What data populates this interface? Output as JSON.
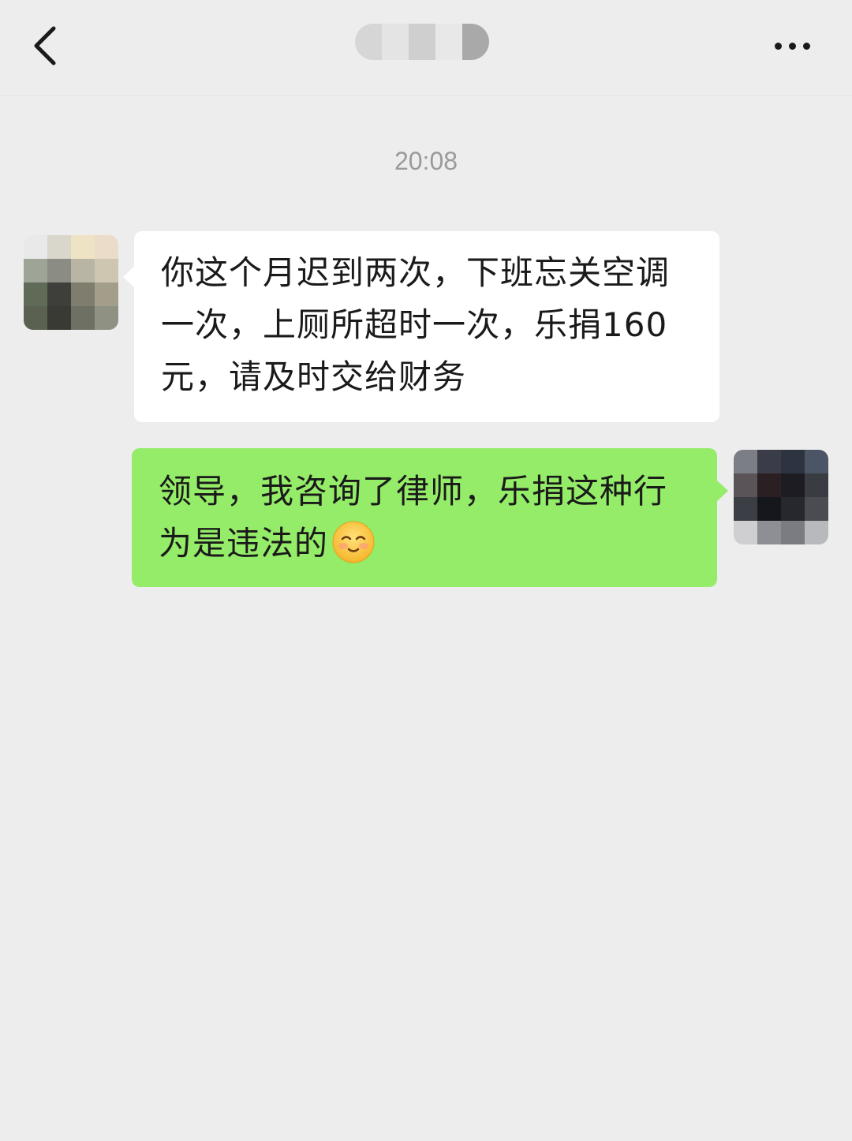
{
  "header": {
    "title_blur_colors": [
      "#d6d6d6",
      "#e4e4e4",
      "#cfcfcf",
      "#e8e8e8",
      "#a9a9a9"
    ]
  },
  "timestamp": "20:08",
  "messages": [
    {
      "direction": "received",
      "text": "你这个月迟到两次，下班忘关空调一次，上厕所超时一次，乐捐160元，请及时交给财务",
      "avatar_colors": [
        "#e9e9e9",
        "#d9d6cc",
        "#efe3c6",
        "#eadcc8",
        "#9ea596",
        "#8b8c84",
        "#b9b5a4",
        "#cfc6b2",
        "#5f6b56",
        "#3e3f3a",
        "#7f7d6d",
        "#a39e8a",
        "#5a6150",
        "#3a3a34",
        "#6e7064",
        "#8f9283"
      ],
      "bubble_color": "#ffffff"
    },
    {
      "direction": "sent",
      "text": "领导，我咨询了律师，乐捐这种行为是违法的",
      "emoji": "smiling-blush-emoji",
      "avatar_colors": [
        "#7c7e86",
        "#3a3d48",
        "#2d3340",
        "#4b5566",
        "#5a5458",
        "#2a2024",
        "#1c1c22",
        "#3a3c44",
        "#3c3e46",
        "#15171c",
        "#26282e",
        "#4a4c52",
        "#cfcfd2",
        "#8e8f95",
        "#7a7c82",
        "#b8b9bd"
      ],
      "bubble_color": "#95ec69"
    }
  ]
}
